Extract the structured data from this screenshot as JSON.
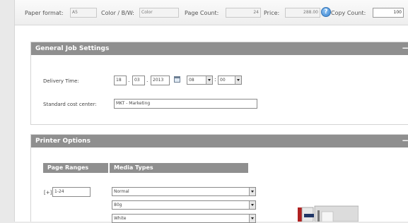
{
  "toolbar": {
    "paper_format_label": "Paper format:",
    "paper_format_value": "A5",
    "color_bw_label": "Color / B/W:",
    "color_bw_value": "Color",
    "page_count_label": "Page Count:",
    "page_count_value": "24",
    "price_label": "Price:",
    "price_value": "288.00",
    "copy_count_label": "Copy Count:",
    "copy_count_value": "100"
  },
  "general": {
    "title": "General Job Settings",
    "delivery_label": "Delivery Time:",
    "day": "18",
    "month": "03",
    "year": "2013",
    "hour": "08",
    "minute": "00",
    "date_sep": ".",
    "time_sep": ":",
    "cost_center_label": "Standard cost center:",
    "cost_center_value": "MKT - Marketing"
  },
  "printer": {
    "title": "Printer Options",
    "page_ranges_header": "Page Ranges",
    "media_types_header": "Media Types",
    "range_prefix": "[+]",
    "range_value": "1-24",
    "media": [
      "Normal",
      "80g",
      "White"
    ]
  },
  "icons": {
    "help": "help-icon",
    "calendar": "calendar-icon",
    "collapse": "collapse-icon",
    "printer": "printer-icon"
  },
  "colors": {
    "header_gray": "#8f8f8f",
    "help_blue": "#3a84cf",
    "printer_red": "#b02020",
    "printer_navy": "#1f3565"
  }
}
